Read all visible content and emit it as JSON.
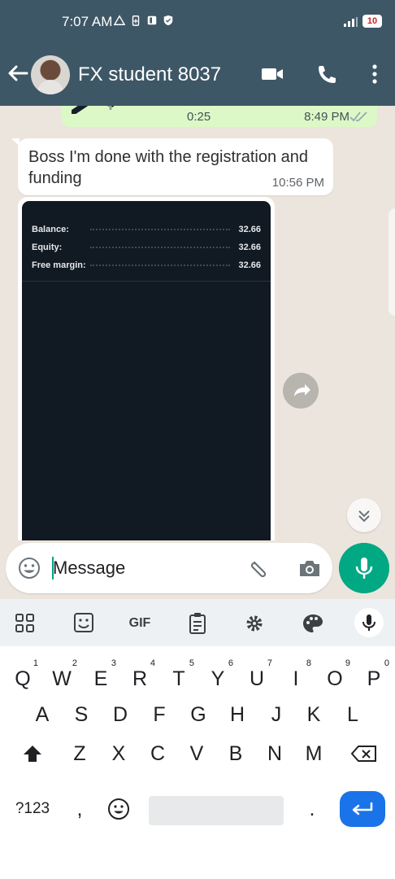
{
  "status": {
    "time": "7:07 AM",
    "battery": "10"
  },
  "header": {
    "contact_name": "FX student 8037"
  },
  "voice": {
    "duration": "0:25",
    "time": "8:49 PM"
  },
  "message": {
    "text": "Boss I'm done with the registration and funding",
    "time": "10:56 PM"
  },
  "screenshot": {
    "rows": [
      {
        "label": "Balance:",
        "value": "32.66"
      },
      {
        "label": "Equity:",
        "value": "32.66"
      },
      {
        "label": "Free margin:",
        "value": "32.66"
      }
    ]
  },
  "composer": {
    "placeholder": "Message"
  },
  "keyboard": {
    "toolbar": {
      "gif": "GIF"
    },
    "row1": [
      "Q",
      "W",
      "E",
      "R",
      "T",
      "Y",
      "U",
      "I",
      "O",
      "P"
    ],
    "row1_hints": [
      "1",
      "2",
      "3",
      "4",
      "5",
      "6",
      "7",
      "8",
      "9",
      "0"
    ],
    "row2": [
      "A",
      "S",
      "D",
      "F",
      "G",
      "H",
      "J",
      "K",
      "L"
    ],
    "row3": [
      "Z",
      "X",
      "C",
      "V",
      "B",
      "N",
      "M"
    ],
    "symbols": "?123",
    "comma": ",",
    "period": "."
  },
  "colors": {
    "header": "#3e5766",
    "accent": "#00a884",
    "outgoing": "#dcf8c6",
    "enter": "#1a73e8"
  }
}
